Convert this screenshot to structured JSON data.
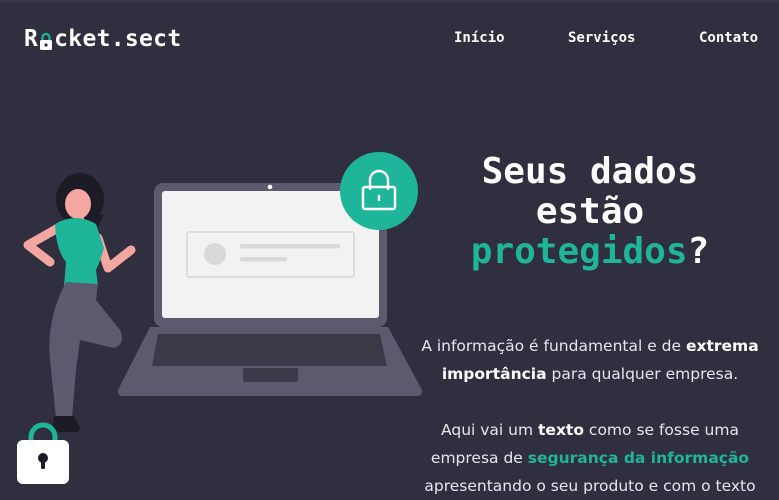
{
  "brand": {
    "logo_prefix": "R",
    "logo_suffix": "cket.sect",
    "accent_color": "#1fb59b",
    "background_color": "#302f3f"
  },
  "nav": {
    "items": [
      {
        "label": "Início"
      },
      {
        "label": "Serviços"
      },
      {
        "label": "Contato"
      }
    ]
  },
  "hero": {
    "headline_line1": "Seus dados",
    "headline_line2": "estão",
    "headline_accent": "protegidos",
    "headline_mark": "?",
    "paragraph1": {
      "t1": "A informação é fundamental e de ",
      "b1": "extrema importância",
      "t2": " para qualquer empresa."
    },
    "paragraph2": {
      "t1": "Aqui vai um ",
      "b1": "texto",
      "t2": " como se fosse uma empresa de ",
      "b2": "segurança da informação",
      "t3": " apresentando o seu produto e com o texto"
    }
  },
  "illustration": {
    "laptop_icon": "lock-icon",
    "floating_icon": "padlock-icon"
  }
}
